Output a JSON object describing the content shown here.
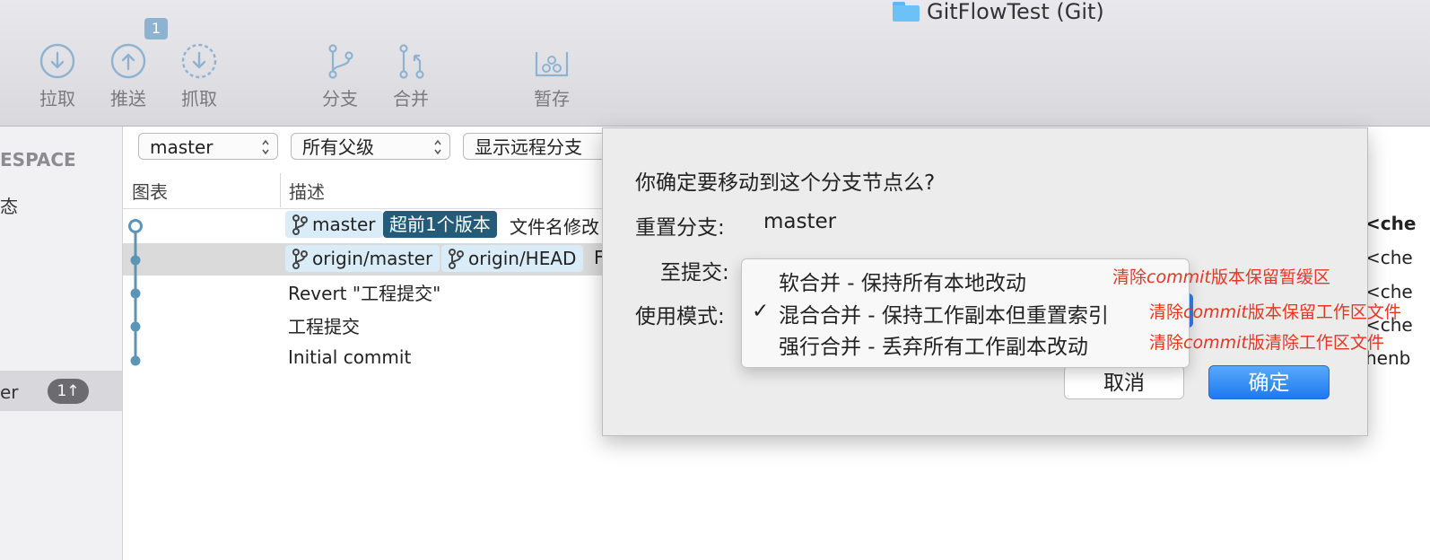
{
  "window": {
    "title": "GitFlowTest (Git)"
  },
  "toolbar": {
    "pull": "拉取",
    "push": "推送",
    "push_badge": "1",
    "fetch": "抓取",
    "branch": "分支",
    "merge": "合并",
    "stash": "暂存"
  },
  "sidebar": {
    "section": "ESPACE",
    "item_status": "态",
    "selected_item": "er",
    "selected_badge": "1↑"
  },
  "filters": {
    "branch": "master",
    "parents": "所有父级",
    "remote": "显示远程分支"
  },
  "table": {
    "col_graph": "图表",
    "col_desc": "描述",
    "row1_tag_branch": "master",
    "row1_tag_ahead": "超前1个版本",
    "row1_text": "文件名修改",
    "row2_tag1": "origin/master",
    "row2_tag2": "origin/HEAD",
    "row2_text": "F",
    "row3_text": "Revert \"工程提交\"",
    "row4_text": "工程提交",
    "row5_text": "Initial commit",
    "right_col": [
      "<che",
      "<che",
      "<che",
      "<che",
      "henb"
    ]
  },
  "dialog": {
    "question": "你确定要移动到这个分支节点么?",
    "reset_branch_label": "重置分支:",
    "reset_branch_value": "master",
    "to_commit_label": "至提交:",
    "mode_label": "使用模式:",
    "cancel": "取消",
    "ok": "确定"
  },
  "menu": {
    "items": [
      "软合并 - 保持所有本地改动",
      "混合合并 - 保持工作副本但重置索引",
      "强行合并 - 丢弃所有工作副本改动"
    ],
    "selected_index": 1
  },
  "annotations": [
    {
      "prefix": "清除",
      "italic": "commit",
      "suffix": "版本保留暂缓区"
    },
    {
      "prefix": "清除",
      "italic": "commit",
      "suffix": "版本保留工作区文件"
    },
    {
      "prefix": "清除",
      "italic": "commit",
      "suffix": "版清除工作区文件"
    }
  ],
  "colors": {
    "accent": "#1c7af0",
    "tag_bg": "#d9ecf8",
    "tag_dark": "#235c78",
    "graph_line": "#5b95b8",
    "annotation": "#e53524"
  }
}
